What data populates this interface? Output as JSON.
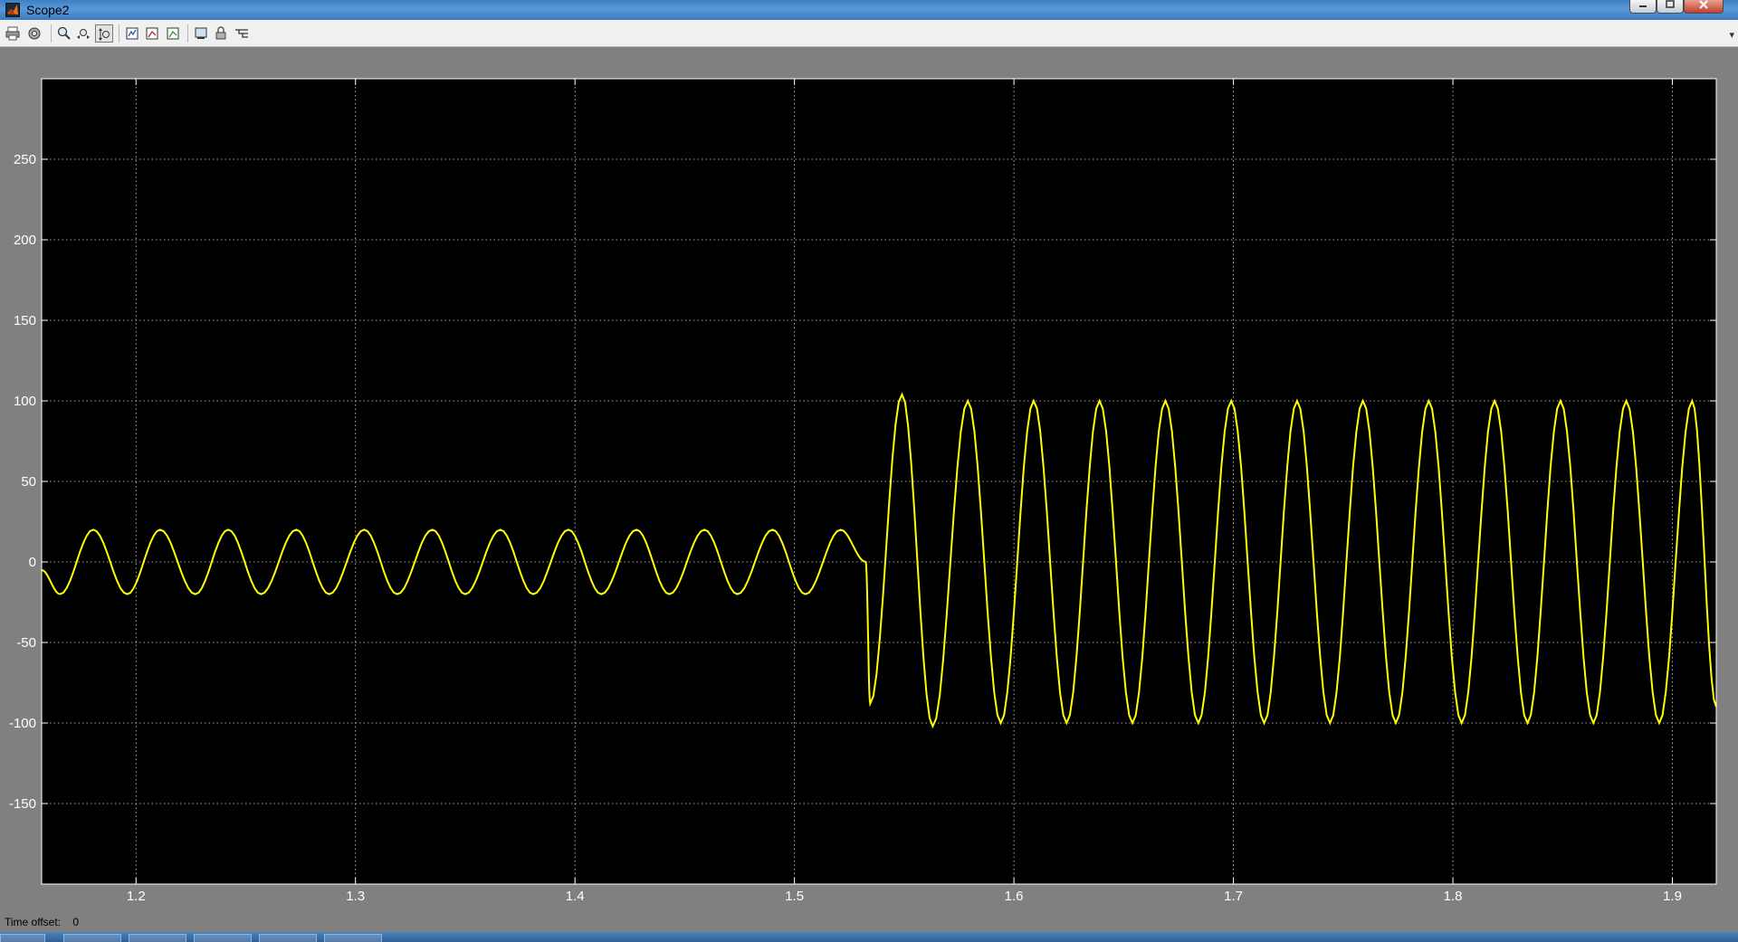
{
  "window": {
    "title": "Scope2",
    "icon": "matlab-icon",
    "controls": [
      "minimize-icon",
      "maximize-icon",
      "close-icon"
    ]
  },
  "toolbar": {
    "buttons": [
      {
        "name": "print-button",
        "icon": "printer-icon"
      },
      {
        "name": "parameters-button",
        "icon": "gear-icon"
      },
      {
        "name": "zoom-button",
        "icon": "magnifier-icon"
      },
      {
        "name": "zoom-x-button",
        "icon": "zoom-x-icon"
      },
      {
        "name": "zoom-y-button",
        "icon": "zoom-y-icon",
        "active": true
      },
      {
        "name": "autoscale-button",
        "icon": "autoscale-icon"
      },
      {
        "name": "save-axes-button",
        "icon": "save-axes-icon"
      },
      {
        "name": "restore-axes-button",
        "icon": "restore-axes-icon"
      },
      {
        "name": "floating-scope-button",
        "icon": "floating-scope-icon"
      },
      {
        "name": "lock-axes-button",
        "icon": "lock-icon"
      },
      {
        "name": "signal-selection-button",
        "icon": "signal-selector-icon"
      }
    ]
  },
  "status": {
    "time_offset_label": "Time offset:",
    "time_offset_value": "0"
  },
  "colors": {
    "plot_background": "#000000",
    "trace": "#ffff00",
    "grid": "#ffffff",
    "frame_background": "#808080"
  },
  "chart_data": {
    "type": "line",
    "title": "",
    "xlabel": "",
    "ylabel": "",
    "xlim": [
      1.157,
      1.92
    ],
    "ylim": [
      -200,
      300
    ],
    "xticks": [
      "1.2",
      "1.3",
      "1.4",
      "1.5",
      "1.6",
      "1.7",
      "1.8",
      "1.9"
    ],
    "xtick_values": [
      1.2,
      1.3,
      1.4,
      1.5,
      1.6,
      1.7,
      1.8,
      1.9
    ],
    "yticks": [
      "-150",
      "-100",
      "-50",
      "0",
      "50",
      "100",
      "150",
      "200",
      "250"
    ],
    "ytick_values": [
      -150,
      -100,
      -50,
      0,
      50,
      100,
      150,
      200,
      250
    ],
    "grid": true,
    "series": [
      {
        "segments": [
          {
            "t_start": 1.157,
            "t_end": 1.5325,
            "amplitude": 20,
            "frequency_hz": 33.0,
            "phase_ref_t": 1.1654
          },
          {
            "t_start": 1.5325,
            "t_end": 1.92,
            "amplitude": 100,
            "frequency_hz": 33.0,
            "phase_ref_t": 1.5345,
            "transient": {
              "first_peak": 104,
              "first_trough": -102
            }
          }
        ],
        "points": [
          {
            "x": 1.157,
            "y": -5
          },
          {
            "x": 1.1654,
            "y": -20
          },
          {
            "x": 1.1805,
            "y": 20
          },
          {
            "x": 1.196,
            "y": -20
          },
          {
            "x": 1.211,
            "y": 20
          },
          {
            "x": 1.227,
            "y": -20
          },
          {
            "x": 1.242,
            "y": 20
          },
          {
            "x": 1.257,
            "y": -20
          },
          {
            "x": 1.273,
            "y": 20
          },
          {
            "x": 1.288,
            "y": -20
          },
          {
            "x": 1.304,
            "y": 20
          },
          {
            "x": 1.319,
            "y": -20
          },
          {
            "x": 1.335,
            "y": 20
          },
          {
            "x": 1.35,
            "y": -20
          },
          {
            "x": 1.366,
            "y": 20
          },
          {
            "x": 1.381,
            "y": -20
          },
          {
            "x": 1.397,
            "y": 20
          },
          {
            "x": 1.412,
            "y": -20
          },
          {
            "x": 1.428,
            "y": 20
          },
          {
            "x": 1.443,
            "y": -20
          },
          {
            "x": 1.459,
            "y": 20
          },
          {
            "x": 1.474,
            "y": -20
          },
          {
            "x": 1.49,
            "y": 20
          },
          {
            "x": 1.505,
            "y": -20
          },
          {
            "x": 1.521,
            "y": 20
          },
          {
            "x": 1.5325,
            "y": 0
          },
          {
            "x": 1.5345,
            "y": -88
          },
          {
            "x": 1.549,
            "y": 104
          },
          {
            "x": 1.563,
            "y": -102
          },
          {
            "x": 1.579,
            "y": 100
          },
          {
            "x": 1.594,
            "y": -100
          },
          {
            "x": 1.609,
            "y": 100
          },
          {
            "x": 1.624,
            "y": -100
          },
          {
            "x": 1.639,
            "y": 100
          },
          {
            "x": 1.654,
            "y": -100
          },
          {
            "x": 1.669,
            "y": 100
          },
          {
            "x": 1.684,
            "y": -100
          },
          {
            "x": 1.699,
            "y": 100
          },
          {
            "x": 1.714,
            "y": -100
          },
          {
            "x": 1.729,
            "y": 100
          },
          {
            "x": 1.744,
            "y": -100
          },
          {
            "x": 1.759,
            "y": 100
          },
          {
            "x": 1.774,
            "y": -100
          },
          {
            "x": 1.789,
            "y": 100
          },
          {
            "x": 1.804,
            "y": -100
          },
          {
            "x": 1.819,
            "y": 100
          },
          {
            "x": 1.834,
            "y": -100
          },
          {
            "x": 1.849,
            "y": 100
          },
          {
            "x": 1.864,
            "y": -100
          },
          {
            "x": 1.879,
            "y": 100
          },
          {
            "x": 1.894,
            "y": -100
          },
          {
            "x": 1.909,
            "y": 100
          },
          {
            "x": 1.92,
            "y": -90
          }
        ]
      }
    ]
  }
}
